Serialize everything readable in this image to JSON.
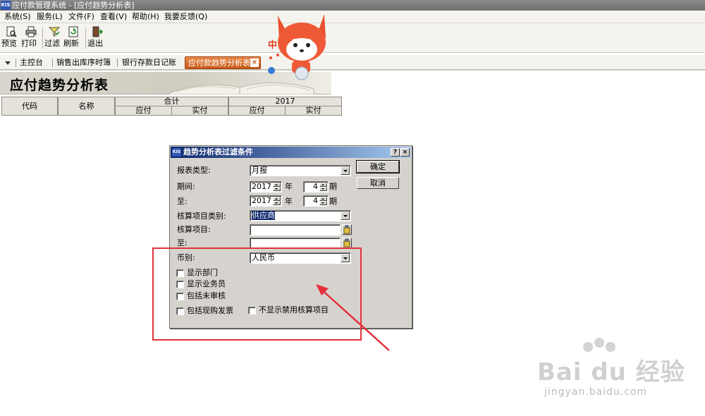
{
  "window": {
    "title": "应付款管理系统 - [应付趋势分析表]",
    "logo": "KIS"
  },
  "menu": [
    "系统(S)",
    "服务(L)",
    "文件(F)",
    "查看(V)",
    "帮助(H)",
    "我要反馈(Q)"
  ],
  "toolbar": {
    "preview": "预览",
    "print": "打印",
    "filter": "过滤",
    "refresh": "刷新",
    "exit": "退出"
  },
  "tabs": {
    "main": "主控台",
    "sales": "销售出库序时簿",
    "bank": "银行存款日记账",
    "active": "应付款趋势分析表",
    "close": "×"
  },
  "report": {
    "title": "应付趋势分析表",
    "headers": {
      "code": "代码",
      "name": "名称",
      "total": "合计",
      "year": "2017",
      "payable": "应付",
      "paid": "实付"
    }
  },
  "dialog": {
    "logo": "KIS",
    "title": "趋势分析表过滤条件",
    "help": "?",
    "close": "×",
    "report_type_label": "报表类型:",
    "report_type_value": "月报",
    "period_label": "期间:",
    "to_label": "至:",
    "period_from_year": "2017",
    "period_from_month": "4",
    "period_to_year": "2017",
    "period_to_month": "4",
    "year_unit": "年",
    "month_unit": "期",
    "item_category_label": "核算项目类别:",
    "item_category_value": "供应商",
    "item_label": "核算项目:",
    "item_value": "",
    "item_to_label": "至:",
    "item_to_value": "",
    "currency_label": "币别:",
    "currency_value": "人民币",
    "ok": "确定",
    "cancel": "取消",
    "checkboxes": {
      "show_dept": "显示部门",
      "show_salesman": "显示业务员",
      "include_unaudited": "包括未审核",
      "include_cash_invoice": "包括现购发票",
      "hide_disabled": "不显示禁用核算项目"
    }
  },
  "mascot": {
    "badge": "中"
  },
  "watermark": {
    "brand": "Bai du 经验",
    "url": "jingyan.baidu.com"
  },
  "colors": {
    "title_bar": "#6e6e6e",
    "active_tab": "#c75715",
    "dialog_title": "#0a246a",
    "annotation": "#e5303a"
  }
}
